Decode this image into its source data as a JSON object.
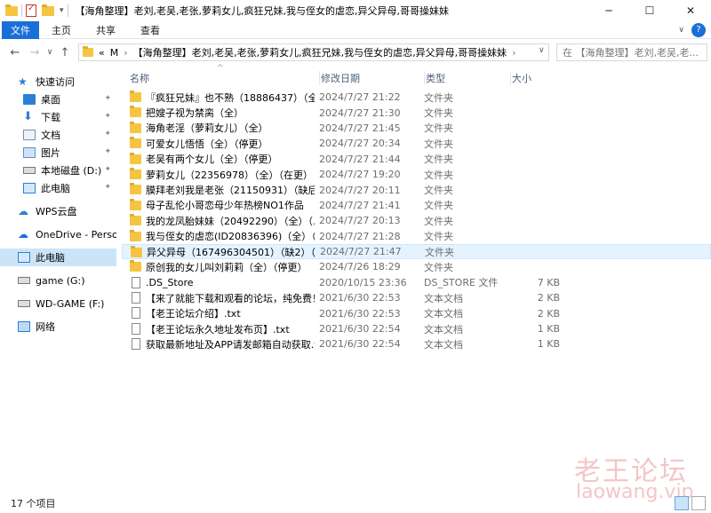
{
  "window": {
    "title": "【海角整理】老刘,老吴,老张,萝莉女儿,疯狂兄妹,我与侄女的虐恋,异父异母,哥哥操妹妹",
    "controls": [
      "─",
      "☐",
      "✕"
    ]
  },
  "ribbon": {
    "tabs": [
      "文件",
      "主页",
      "共享",
      "查看"
    ],
    "help": "?"
  },
  "address": {
    "prefix": "«",
    "crumb1": "M",
    "crumb2": "【海角整理】老刘,老吴,老张,萝莉女儿,疯狂兄妹,我与侄女的虐恋,异父异母,哥哥操妹妹",
    "search_placeholder": "在 【海角整理】老刘,老吴,老..."
  },
  "sidebar": {
    "items": [
      {
        "label": "快速访问",
        "icon": "star-icon"
      },
      {
        "label": "桌面",
        "icon": "desktop-icon"
      },
      {
        "label": "下载",
        "icon": "download-icon"
      },
      {
        "label": "文档",
        "icon": "document-icon"
      },
      {
        "label": "图片",
        "icon": "picture-icon"
      },
      {
        "label": "本地磁盘 (D:)",
        "icon": "drive-icon"
      },
      {
        "label": "此电脑",
        "icon": "computer-icon"
      },
      {
        "label": "WPS云盘",
        "icon": "cloud-icon"
      },
      {
        "label": "OneDrive - Persona",
        "icon": "onedrive-icon"
      },
      {
        "label": "此电脑",
        "icon": "computer-icon"
      },
      {
        "label": "game (G:)",
        "icon": "drive-icon"
      },
      {
        "label": "WD-GAME (F:)",
        "icon": "drive-icon"
      },
      {
        "label": "网络",
        "icon": "network-icon"
      }
    ]
  },
  "columns": {
    "name": "名称",
    "date": "修改日期",
    "type": "类型",
    "size": "大小"
  },
  "files": [
    {
      "name": "『疯狂兄妹』也不熟（18886437）（全...",
      "date": "2024/7/27 21:22",
      "type": "文件夹",
      "size": "",
      "kind": "folder"
    },
    {
      "name": "把嫂子视为禁脔（全）",
      "date": "2024/7/27 21:30",
      "type": "文件夹",
      "size": "",
      "kind": "folder"
    },
    {
      "name": "海角老淫（萝莉女儿）（全）",
      "date": "2024/7/27 21:45",
      "type": "文件夹",
      "size": "",
      "kind": "folder"
    },
    {
      "name": "可爱女儿悟悟（全）（停更）",
      "date": "2024/7/27 20:34",
      "type": "文件夹",
      "size": "",
      "kind": "folder"
    },
    {
      "name": "老吴有两个女儿（全）（停更）",
      "date": "2024/7/27 21:44",
      "type": "文件夹",
      "size": "",
      "kind": "folder"
    },
    {
      "name": "萝莉女儿（22356978）（全）（在更）",
      "date": "2024/7/27 19:20",
      "type": "文件夹",
      "size": "",
      "kind": "folder"
    },
    {
      "name": "膜拜老刘我是老张（21150931）（缺后...",
      "date": "2024/7/27 20:11",
      "type": "文件夹",
      "size": "",
      "kind": "folder"
    },
    {
      "name": "母子乱伦小哥恋母少年热榜NO1作品",
      "date": "2024/7/27 21:41",
      "type": "文件夹",
      "size": "",
      "kind": "folder"
    },
    {
      "name": "我的龙凤胎妹妹（20492290）（全）（...",
      "date": "2024/7/27 20:13",
      "type": "文件夹",
      "size": "",
      "kind": "folder"
    },
    {
      "name": "我与侄女的虐恋(ID20836396)（全）（...",
      "date": "2024/7/27 21:28",
      "type": "文件夹",
      "size": "",
      "kind": "folder"
    },
    {
      "name": "异父异母（167496304501）（缺2）（...",
      "date": "2024/7/27 21:47",
      "type": "文件夹",
      "size": "",
      "kind": "folder",
      "selected": true
    },
    {
      "name": "原创我的女儿叫刘莉莉（全）（停更）",
      "date": "2024/7/26 18:29",
      "type": "文件夹",
      "size": "",
      "kind": "folder"
    },
    {
      "name": ".DS_Store",
      "date": "2020/10/15 23:36",
      "type": "DS_STORE 文件",
      "size": "7 KB",
      "kind": "doc"
    },
    {
      "name": "【来了就能下载和观看的论坛，纯免费！...",
      "date": "2021/6/30 22:53",
      "type": "文本文档",
      "size": "2 KB",
      "kind": "doc"
    },
    {
      "name": "【老王论坛介绍】.txt",
      "date": "2021/6/30 22:53",
      "type": "文本文档",
      "size": "2 KB",
      "kind": "doc"
    },
    {
      "name": "【老王论坛永久地址发布页】.txt",
      "date": "2021/6/30 22:54",
      "type": "文本文档",
      "size": "1 KB",
      "kind": "doc"
    },
    {
      "name": "获取最新地址及APP请发邮箱自动获取.txt",
      "date": "2021/6/30 22:54",
      "type": "文本文档",
      "size": "1 KB",
      "kind": "doc"
    }
  ],
  "status": {
    "count": "17 个项目"
  },
  "watermark": {
    "line1": "老王论坛",
    "line2": "laowang.vip"
  },
  "colors": {
    "accent": "#1a6ed8",
    "folder": "#f5c542",
    "selection": "#e5f3ff"
  }
}
